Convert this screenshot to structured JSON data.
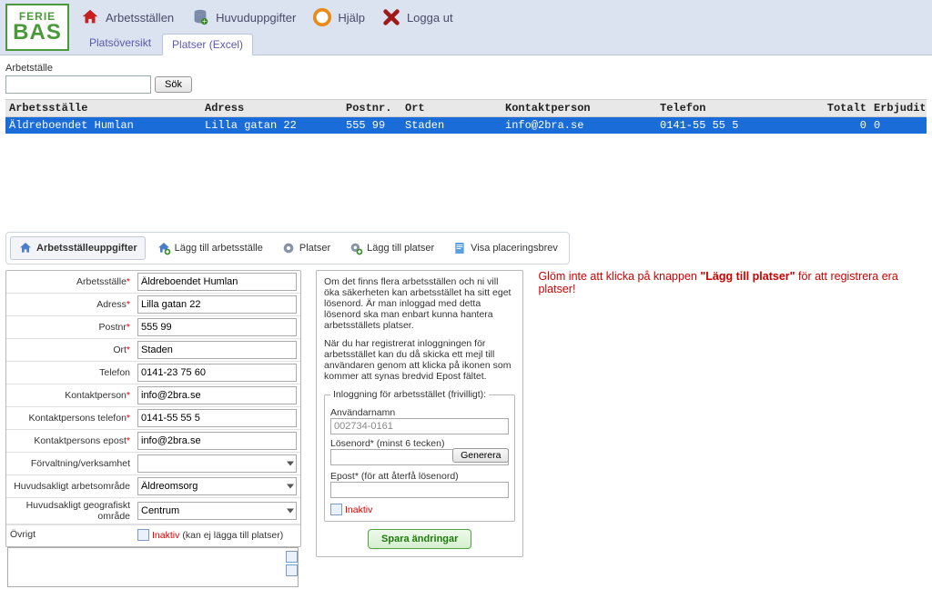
{
  "logo": {
    "top": "FERIE",
    "bottom": "BAS"
  },
  "menu": {
    "arbetsstallen": "Arbetsställen",
    "huvuduppgifter": "Huvuduppgifter",
    "hjalp": "Hjälp",
    "loggaut": "Logga ut"
  },
  "submenu": {
    "platsoversikt": "Platsöversikt",
    "platser_excel": "Platser (Excel)"
  },
  "search": {
    "label": "Arbetställe",
    "button": "Sök",
    "value": ""
  },
  "grid": {
    "headers": {
      "arbetsstalle": "Arbetsställe",
      "adress": "Adress",
      "postnr": "Postnr.",
      "ort": "Ort",
      "kontaktperson": "Kontaktperson",
      "telefon": "Telefon",
      "totalt": "Totalt",
      "erbjudits": "Erbjudits"
    },
    "rows": [
      {
        "arbetsstalle": "Äldreboendet Humlan",
        "adress": "Lilla gatan 22",
        "postnr": "555 99",
        "ort": "Staden",
        "kontaktperson": "info@2bra.se",
        "telefon": "0141-55 55 5",
        "totalt": "0",
        "erbjudits": "0"
      }
    ]
  },
  "toolbar": {
    "uppgifter": "Arbetsställeuppgifter",
    "lagg_arb": "Lägg till arbetsställe",
    "platser": "Platser",
    "lagg_plats": "Lägg till platser",
    "placeringsbrev": "Visa placeringsbrev"
  },
  "form": {
    "labels": {
      "arbetsstalle": "Arbetsställe",
      "adress": "Adress",
      "postnr": "Postnr",
      "ort": "Ort",
      "telefon": "Telefon",
      "kontaktperson": "Kontaktperson",
      "kontakt_tel": "Kontaktpersons telefon",
      "kontakt_epost": "Kontaktpersons epost",
      "forvaltning": "Förvaltning/verksamhet",
      "arbetsomrade": "Huvudsakligt arbetsområde",
      "geoomrade": "Huvudsakligt geografiskt område",
      "ovrigt": "Övrigt",
      "inaktiv": "Inaktiv",
      "inaktiv_suffix": " (kan ej lägga till platser)"
    },
    "values": {
      "arbetsstalle": "Äldreboendet Humlan",
      "adress": "Lilla gatan 22",
      "postnr": "555 99",
      "ort": "Staden",
      "telefon": "0141-23 75 60",
      "kontaktperson": "info@2bra.se",
      "kontakt_tel": "0141-55 55 5",
      "kontakt_epost": "info@2bra.se",
      "forvaltning": "",
      "arbetsomrade": "Äldreomsorg",
      "geoomrade": "Centrum",
      "ovrigt": ""
    }
  },
  "info": {
    "p1": "Om det finns flera arbetsställen och ni vill öka säkerheten kan arbetsstället ha sitt eget lösenord. Är man inloggad med detta lösenord ska man enbart kunna hantera arbetsställets platser.",
    "p2": "När du har registrerat inloggningen för arbetsstället kan du då skicka ett mejl till användaren genom att klicka på ikonen som kommer att synas bredvid Epost fältet."
  },
  "login": {
    "legend": "Inloggning för arbetsstället (frivilligt):",
    "anvandarnamn_label": "Användarnamn",
    "anvandarnamn_value": "002734-0161",
    "losenord_label": "Lösenord* (minst 6 tecken)",
    "losenord_value": "",
    "generera": "Generera",
    "epost_label": "Epost* (för att återfå lösenord)",
    "epost_value": "",
    "inaktiv": "Inaktiv",
    "save": "Spara ändringar"
  },
  "warning": {
    "pre": "Glöm inte att klicka på knappen ",
    "bold": "\"Lägg till platser\"",
    "post": " för att registrera era platser!"
  }
}
